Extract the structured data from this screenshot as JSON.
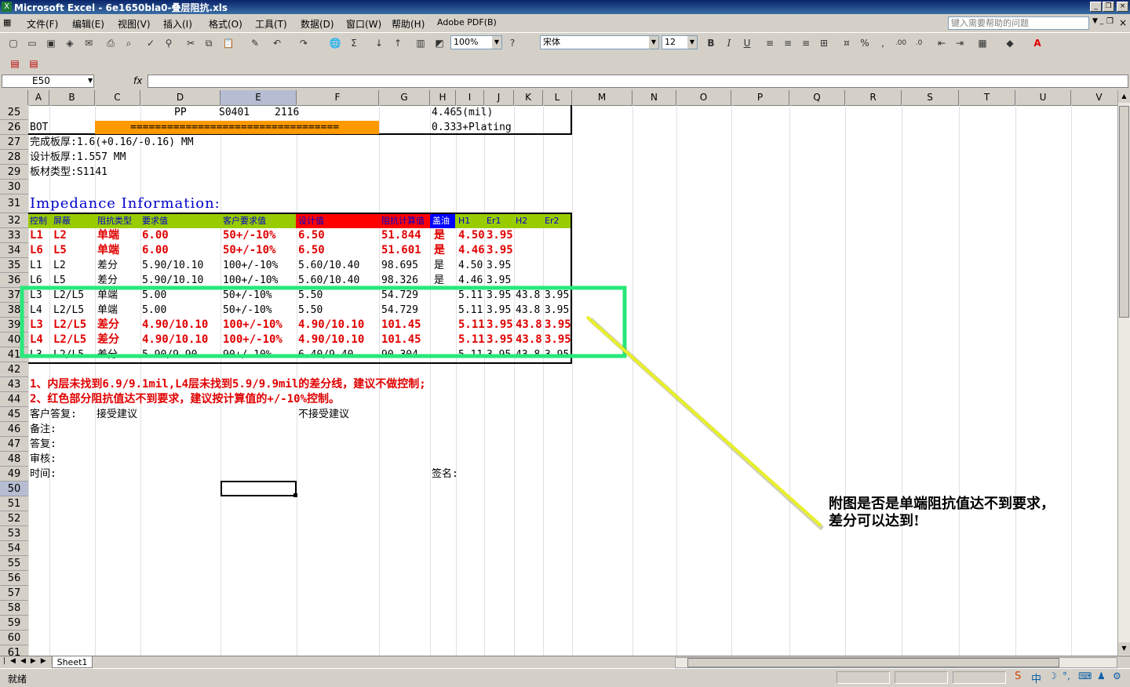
{
  "window": {
    "title": "Microsoft Excel - 6e1650bla0-叠层阻抗.xls"
  },
  "menu": [
    "文件(F)",
    "编辑(E)",
    "视图(V)",
    "插入(I)",
    "格式(O)",
    "工具(T)",
    "数据(D)",
    "窗口(W)",
    "帮助(H)",
    "Adobe PDF(B)"
  ],
  "help_placeholder": "键入需要帮助的问题",
  "toolbar": {
    "zoom": "100%",
    "font": "宋体",
    "size": "12"
  },
  "name_box": "E50",
  "fx": "fx",
  "columns": [
    "A",
    "B",
    "C",
    "D",
    "E",
    "F",
    "G",
    "H",
    "I",
    "J",
    "K",
    "L",
    "M",
    "N",
    "O",
    "P",
    "Q",
    "R",
    "S",
    "T",
    "U",
    "V"
  ],
  "rows": [
    "25",
    "26",
    "27",
    "28",
    "29",
    "30",
    "31",
    "32",
    "33",
    "34",
    "35",
    "36",
    "37",
    "38",
    "39",
    "40",
    "41",
    "42",
    "43",
    "44",
    "45",
    "46",
    "47",
    "48",
    "49",
    "50",
    "51",
    "52",
    "53",
    "54",
    "55",
    "56",
    "57",
    "58",
    "59",
    "60",
    "61"
  ],
  "sheet": {
    "r25": {
      "pp": "PP",
      "code": "S0401",
      "num": "2116",
      "h": "4.465(mil)"
    },
    "r26": {
      "label": "BOT",
      "bar": "==================================",
      "h": "0.333+Plating"
    },
    "r27": "完成板厚:1.6(+0.16/-0.16) MM",
    "r28": "设计板厚:1.557 MM",
    "r29": "板材类型:S1141",
    "r31": "Impedance Information:",
    "header": [
      "控制",
      "屏蔽",
      "阻抗类型",
      "要求值",
      "客户要求值",
      "设计值",
      "阻抗计算值",
      "盖油",
      "H1",
      "Er1",
      "H2",
      "Er2"
    ],
    "data": [
      {
        "a": "L1",
        "b": "L2",
        "c": "单端",
        "d": "6.00",
        "e": "50+/-10%",
        "f": "6.50",
        "g": "51.844",
        "h": "是",
        "i": "4.50",
        "j": "3.95",
        "k": "",
        "l": "",
        "red": true
      },
      {
        "a": "L6",
        "b": "L5",
        "c": "单端",
        "d": "6.00",
        "e": "50+/-10%",
        "f": "6.50",
        "g": "51.601",
        "h": "是",
        "i": "4.46",
        "j": "3.95",
        "k": "",
        "l": "",
        "red": true
      },
      {
        "a": "L1",
        "b": "L2",
        "c": "差分",
        "d": "5.90/10.10",
        "e": "100+/-10%",
        "f": "5.60/10.40",
        "g": "98.695",
        "h": "是",
        "i": "4.50",
        "j": "3.95",
        "k": "",
        "l": "",
        "red": false
      },
      {
        "a": "L6",
        "b": "L5",
        "c": "差分",
        "d": "5.90/10.10",
        "e": "100+/-10%",
        "f": "5.60/10.40",
        "g": "98.326",
        "h": "是",
        "i": "4.46",
        "j": "3.95",
        "k": "",
        "l": "",
        "red": false
      },
      {
        "a": "L3",
        "b": "L2/L5",
        "c": "单端",
        "d": "5.00",
        "e": "50+/-10%",
        "f": "5.50",
        "g": "54.729",
        "h": "",
        "i": "5.11",
        "j": "3.95",
        "k": "43.8",
        "l": "3.95",
        "red": false
      },
      {
        "a": "L4",
        "b": "L2/L5",
        "c": "单端",
        "d": "5.00",
        "e": "50+/-10%",
        "f": "5.50",
        "g": "54.729",
        "h": "",
        "i": "5.11",
        "j": "3.95",
        "k": "43.8",
        "l": "3.95",
        "red": false
      },
      {
        "a": "L3",
        "b": "L2/L5",
        "c": "差分",
        "d": "4.90/10.10",
        "e": "100+/-10%",
        "f": "4.90/10.10",
        "g": "101.45",
        "h": "",
        "i": "5.11",
        "j": "3.95",
        "k": "43.8",
        "l": "3.95",
        "red": true
      },
      {
        "a": "L4",
        "b": "L2/L5",
        "c": "差分",
        "d": "4.90/10.10",
        "e": "100+/-10%",
        "f": "4.90/10.10",
        "g": "101.45",
        "h": "",
        "i": "5.11",
        "j": "3.95",
        "k": "43.8",
        "l": "3.95",
        "red": true
      },
      {
        "a": "L3",
        "b": "L2/L5",
        "c": "差分",
        "d": "5.90/9.90",
        "e": "90+/-10%",
        "f": "6.40/9.40",
        "g": "90.304",
        "h": "",
        "i": "5.11",
        "j": "3.95",
        "k": "43.8",
        "l": "3.95",
        "red": false
      }
    ],
    "r43": "1、内层未找到6.9/9.1mil,L4层未找到5.9/9.9mil的差分线，建议不做控制;",
    "r44": "2、红色部分阻抗值达不到要求，建议按计算值的+/-10%控制。",
    "r45a": "客户答复:",
    "r45b": "接受建议",
    "r45c": "不接受建议",
    "r46": "备注:",
    "r47": "答复:",
    "r48": "审核:",
    "r49a": "时间:",
    "r49b": "签名:"
  },
  "annotation": "附图是否是单端阻抗值达不到要求，差分可以达到!",
  "sheet_tab": "Sheet1",
  "status": "就绪",
  "colors": {
    "highlight_box": "#27e87a",
    "arrow": "#e8ef2a",
    "orange": "#ff9900",
    "green": "#99cc00",
    "red_header": "#ff0000",
    "blue_header": "#0000ff"
  }
}
